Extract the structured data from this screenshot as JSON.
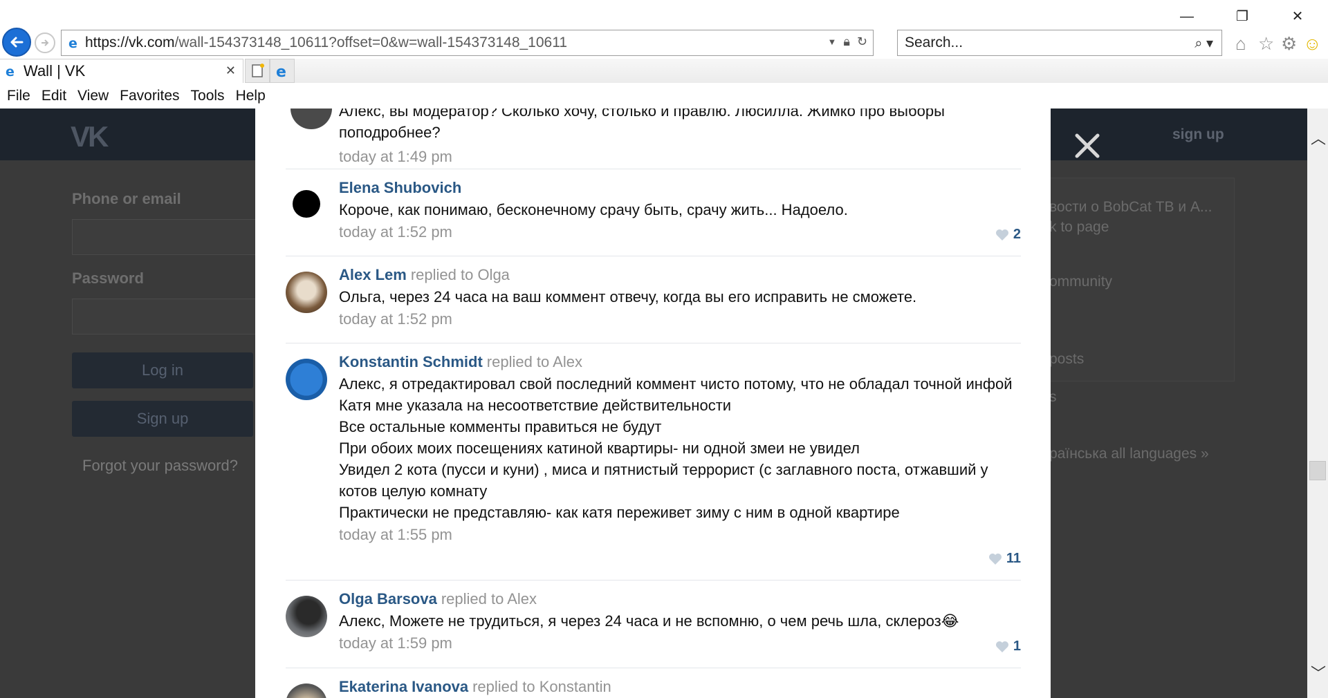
{
  "browser": {
    "address_prefix": "https://vk.com",
    "address_rest": "/wall-154373148_10611?offset=0&w=wall-154373148_10611",
    "search_placeholder": "Search...",
    "tab_title": "Wall | VK",
    "menu": [
      "File",
      "Edit",
      "View",
      "Favorites",
      "Tools",
      "Help"
    ]
  },
  "background_page": {
    "phone_label": "Phone or email",
    "password_label": "Password",
    "login_button": "Log in",
    "signup_button": "Sign up",
    "forgot": "Forgot your password?",
    "header_signup": "sign up",
    "right_texts": [
      "вости о BobCat ТВ и А...",
      "k to page",
      "ommunity",
      "posts",
      "s",
      "раїнська  all languages »"
    ]
  },
  "post": {
    "top_text": "Алекс, вы модератор? Сколько хочу, столько и правлю. Люсилла. Жимко про выборы поподробнее?",
    "top_time": "today at 1:49 pm"
  },
  "comments": [
    {
      "author": "Elena Shubovich",
      "replied": "",
      "lines": [
        "Короче, как понимаю, бесконечному срачу быть, срачу жить... Надоело."
      ],
      "time": "today at 1:52 pm",
      "likes": "2"
    },
    {
      "author": "Alex Lem",
      "replied": "replied to Olga",
      "lines": [
        "Ольга, через 24 часа на ваш коммент отвечу, когда вы его исправить не сможете."
      ],
      "time": "today at 1:52 pm",
      "likes": ""
    },
    {
      "author": "Konstantin Schmidt",
      "replied": "replied to Alex",
      "lines": [
        "Алекс, я отредактировал свой последний коммент чисто потому, что не обладал точной инфой",
        "Катя мне указала на несоответствие действительности",
        "Все остальные комменты правиться не будут",
        "При обоих моих посещениях катиной квартиры- ни одной змеи не увидел",
        "Увидел 2 кота (пусси и куни) , миса и пятнистый террорист (с заглавного поста, отжавший у котов целую комнату",
        "Практически не представляю- как катя переживет зиму с ним в одной квартире"
      ],
      "time": "today at 1:55 pm",
      "likes": "11"
    },
    {
      "author": "Olga Barsova",
      "replied": "replied to Alex",
      "lines": [
        "Алекс, Можете не трудиться, я через 24 часа и не вспомню, о чем речь шла, склероз😂"
      ],
      "time": "today at 1:59 pm",
      "likes": "1"
    },
    {
      "author": "Ekaterina Ivanova",
      "replied": "replied to Konstantin",
      "lines": [],
      "time": "",
      "likes": ""
    }
  ],
  "colors": {
    "vk_blue": "#2a5885",
    "muted": "#939393",
    "overlay": "#3a3a3a"
  }
}
